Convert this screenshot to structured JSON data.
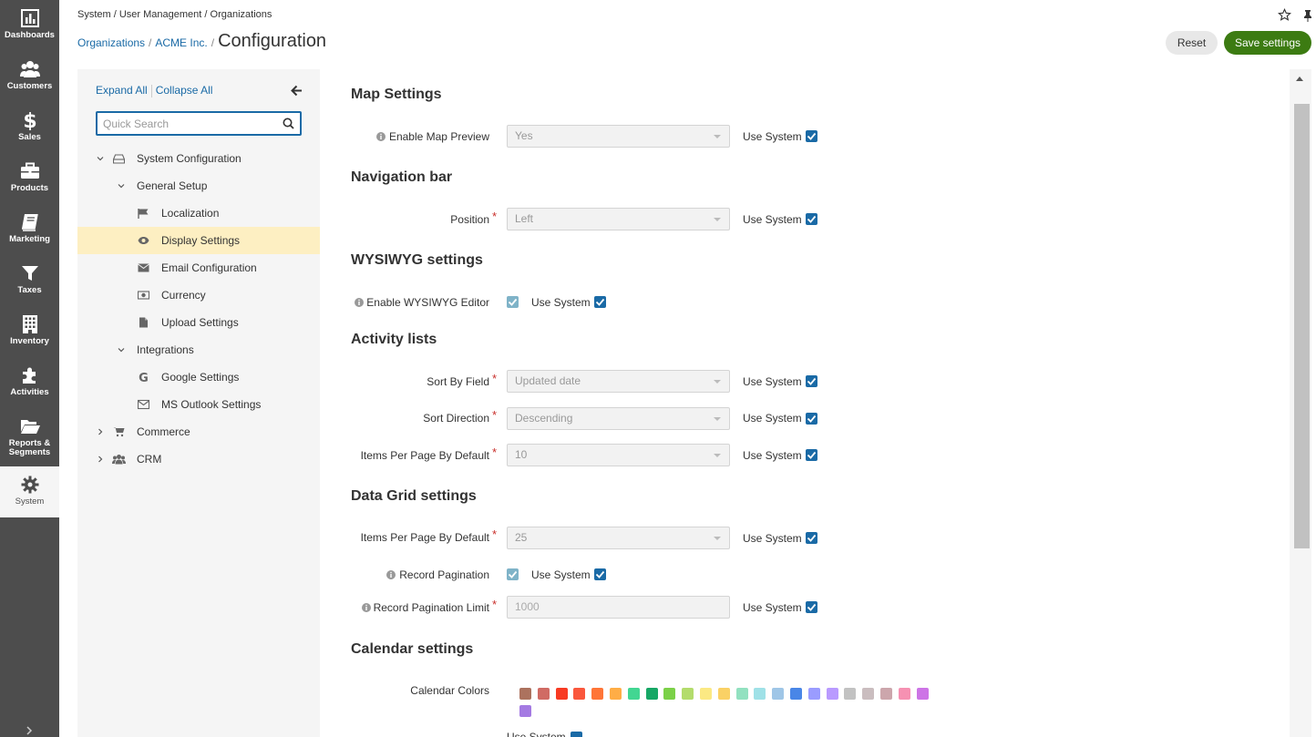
{
  "mainnav": {
    "items": [
      {
        "label": "Dashboards",
        "icon": "bar-chart-icon"
      },
      {
        "label": "Customers",
        "icon": "users-icon"
      },
      {
        "label": "Sales",
        "icon": "dollar-icon"
      },
      {
        "label": "Products",
        "icon": "briefcase-icon"
      },
      {
        "label": "Marketing",
        "icon": "book-icon"
      },
      {
        "label": "Taxes",
        "icon": "filter-icon"
      },
      {
        "label": "Inventory",
        "icon": "building-icon"
      },
      {
        "label": "Activities",
        "icon": "puzzle-icon"
      },
      {
        "label": "Reports &",
        "label2": "Segments",
        "icon": "folder-open-icon"
      },
      {
        "label": "System",
        "icon": "gear-icon"
      }
    ]
  },
  "header": {
    "breadcrumb": {
      "system": "System",
      "user_management": "User Management",
      "organizations": "Organizations"
    },
    "crumbs": {
      "organizations": "Organizations",
      "org": "ACME Inc.",
      "title": "Configuration"
    },
    "reset_label": "Reset",
    "save_label": "Save settings"
  },
  "sidebar": {
    "expand_all": "Expand All",
    "collapse_all": "Collapse All",
    "search_placeholder": "Quick Search",
    "tree": {
      "system_configuration": "System Configuration",
      "general_setup": "General Setup",
      "localization": "Localization",
      "display_settings": "Display Settings",
      "email_configuration": "Email Configuration",
      "currency": "Currency",
      "upload_settings": "Upload Settings",
      "integrations": "Integrations",
      "google_settings": "Google Settings",
      "ms_outlook_settings": "MS Outlook Settings",
      "commerce": "Commerce",
      "crm": "CRM"
    }
  },
  "content": {
    "use_system": "Use System",
    "map": {
      "title": "Map Settings",
      "enable_map_preview_label": "Enable Map Preview",
      "enable_map_preview_value": "Yes"
    },
    "navbar": {
      "title": "Navigation bar",
      "position_label": "Position",
      "position_value": "Left"
    },
    "wysiwyg": {
      "title": "WYSIWYG settings",
      "enable_label": "Enable WYSIWYG Editor"
    },
    "activity": {
      "title": "Activity lists",
      "sort_by_label": "Sort By Field",
      "sort_by_value": "Updated date",
      "sort_dir_label": "Sort Direction",
      "sort_dir_value": "Descending",
      "per_page_label": "Items Per Page By Default",
      "per_page_value": "10"
    },
    "datagrid": {
      "title": "Data Grid settings",
      "per_page_label": "Items Per Page By Default",
      "per_page_value": "25",
      "pagination_label": "Record Pagination",
      "pagination_limit_label": "Record Pagination Limit",
      "pagination_limit_value": "1000"
    },
    "calendar": {
      "title": "Calendar settings",
      "colors_label": "Calendar Colors",
      "colors": [
        "#ac725e",
        "#d06b64",
        "#f83a22",
        "#fa573c",
        "#ff7537",
        "#ffad46",
        "#42d692",
        "#16a765",
        "#7bd148",
        "#b3dc6c",
        "#fbe983",
        "#fad165",
        "#92e1c0",
        "#9fe1e7",
        "#9fc6e7",
        "#4986e7",
        "#9a9cff",
        "#b99aff",
        "#c2c2c2",
        "#cabdbf",
        "#cca6ac",
        "#f691b2",
        "#cd74e6",
        "#a47ae2"
      ],
      "use_system_label": "Use System"
    }
  },
  "accent": "#1a6aa6",
  "save_color": "#3c7b12"
}
